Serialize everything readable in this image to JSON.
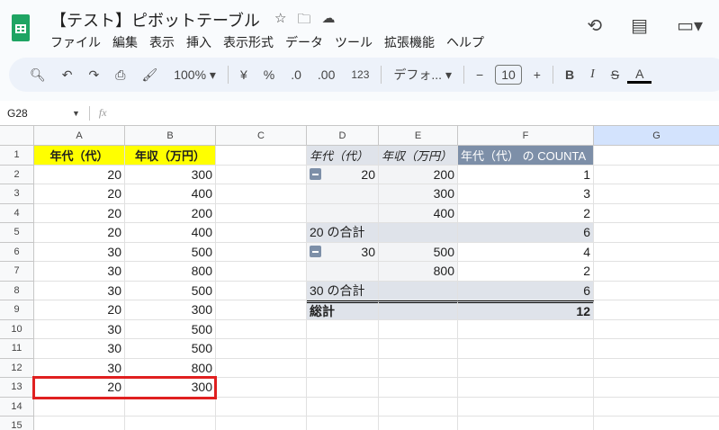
{
  "title": "【テスト】ピボットテーブル",
  "menu": [
    "ファイル",
    "編集",
    "表示",
    "挿入",
    "表示形式",
    "データ",
    "ツール",
    "拡張機能",
    "ヘルプ"
  ],
  "toolbar": {
    "zoom": "100%",
    "currency": "¥",
    "percent": "%",
    "dec_minus": ".0",
    "dec_plus": ".00",
    "format": "123",
    "font": "デフォ...",
    "font_size": "10",
    "bold": "B",
    "italic": "I",
    "text_color": "A"
  },
  "formula_bar": {
    "cell_ref": "G28",
    "fx": "fx",
    "value": ""
  },
  "columns": [
    "A",
    "B",
    "C",
    "D",
    "E",
    "F",
    "G"
  ],
  "rows": [
    "1",
    "2",
    "3",
    "4",
    "5",
    "6",
    "7",
    "8",
    "9",
    "10",
    "11",
    "12",
    "13",
    "14",
    "15"
  ],
  "source_table": {
    "headers": [
      "年代（代）",
      "年収（万円）"
    ],
    "rows": [
      [
        "20",
        "300"
      ],
      [
        "20",
        "400"
      ],
      [
        "20",
        "200"
      ],
      [
        "20",
        "400"
      ],
      [
        "30",
        "500"
      ],
      [
        "30",
        "800"
      ],
      [
        "30",
        "500"
      ],
      [
        "20",
        "300"
      ],
      [
        "30",
        "500"
      ],
      [
        "30",
        "500"
      ],
      [
        "30",
        "800"
      ],
      [
        "20",
        "300"
      ]
    ]
  },
  "pivot": {
    "headers": [
      "年代（代）",
      "年収（万円）",
      "年代（代） の COUNTA"
    ],
    "rows": [
      [
        "20",
        "200",
        "1"
      ],
      [
        "",
        "300",
        "3"
      ],
      [
        "",
        "400",
        "2"
      ],
      [
        "20 の合計",
        "",
        "6"
      ],
      [
        "30",
        "500",
        "4"
      ],
      [
        "",
        "800",
        "2"
      ],
      [
        "30 の合計",
        "",
        "6"
      ],
      [
        "総計",
        "",
        "12"
      ]
    ]
  },
  "colors": {
    "header_yellow": "#ffff00",
    "pivot_header": "#7d8fa8",
    "highlight_border": "#e02020"
  }
}
